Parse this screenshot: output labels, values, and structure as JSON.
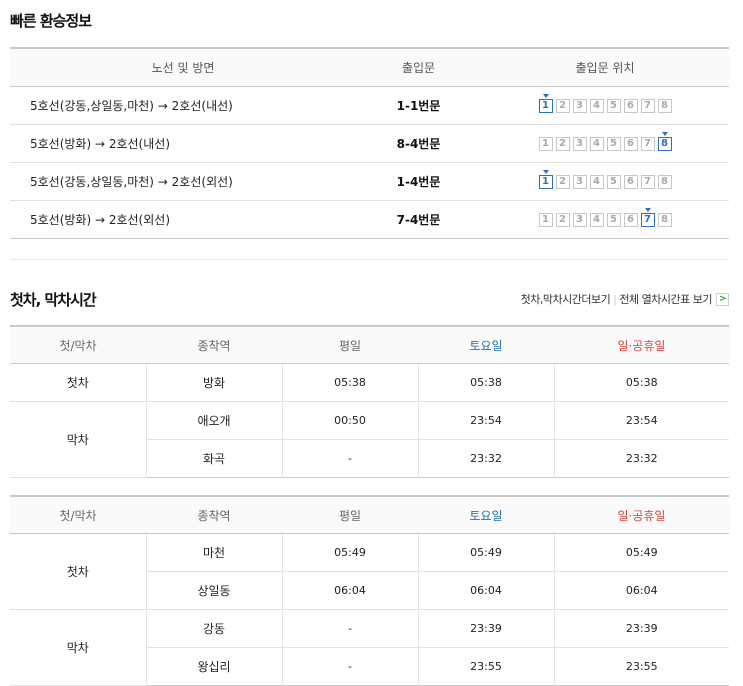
{
  "transfer": {
    "title": "빠른 환승정보",
    "headers": [
      "노선 및 방면",
      "출입문",
      "출입문 위치"
    ],
    "doors": [
      "1",
      "2",
      "3",
      "4",
      "5",
      "6",
      "7",
      "8"
    ],
    "rows": [
      {
        "route": "5호선(강동,상일동,마천) → 2호선(내선)",
        "exit": "1-1번문",
        "active": 1
      },
      {
        "route": "5호선(방화) → 2호선(내선)",
        "exit": "8-4번문",
        "active": 8
      },
      {
        "route": "5호선(강동,상일동,마천) → 2호선(외선)",
        "exit": "1-4번문",
        "active": 1
      },
      {
        "route": "5호선(방화) → 2호선(외선)",
        "exit": "7-4번문",
        "active": 7
      }
    ],
    "active_color": "#2a6fc2"
  },
  "firstlast": {
    "title": "첫차, 막차시간",
    "link_more": "첫차,막차시간더보기",
    "link_sep": "|",
    "link_all": "전체 열차시간표 보기",
    "arrow": ">",
    "headers": {
      "kind": "첫/막차",
      "terminus": "종착역",
      "weekday": "평일",
      "saturday": "토요일",
      "holiday": "일·공휴일"
    },
    "colors": {
      "saturday": "#1f6fb5",
      "holiday": "#d8453e"
    },
    "table1": {
      "groups": [
        {
          "kind": "첫차",
          "rows": [
            {
              "station": "방화",
              "weekday": "05:38",
              "saturday": "05:38",
              "holiday": "05:38"
            }
          ]
        },
        {
          "kind": "막차",
          "rows": [
            {
              "station": "애오개",
              "weekday": "00:50",
              "saturday": "23:54",
              "holiday": "23:54"
            },
            {
              "station": "화곡",
              "weekday": "-",
              "saturday": "23:32",
              "holiday": "23:32"
            }
          ]
        }
      ]
    },
    "table2": {
      "groups": [
        {
          "kind": "첫차",
          "rows": [
            {
              "station": "마천",
              "weekday": "05:49",
              "saturday": "05:49",
              "holiday": "05:49"
            },
            {
              "station": "상일동",
              "weekday": "06:04",
              "saturday": "06:04",
              "holiday": "06:04"
            }
          ]
        },
        {
          "kind": "막차",
          "rows": [
            {
              "station": "강동",
              "weekday": "-",
              "saturday": "23:39",
              "holiday": "23:39"
            },
            {
              "station": "왕십리",
              "weekday": "-",
              "saturday": "23:55",
              "holiday": "23:55"
            }
          ]
        }
      ]
    }
  }
}
